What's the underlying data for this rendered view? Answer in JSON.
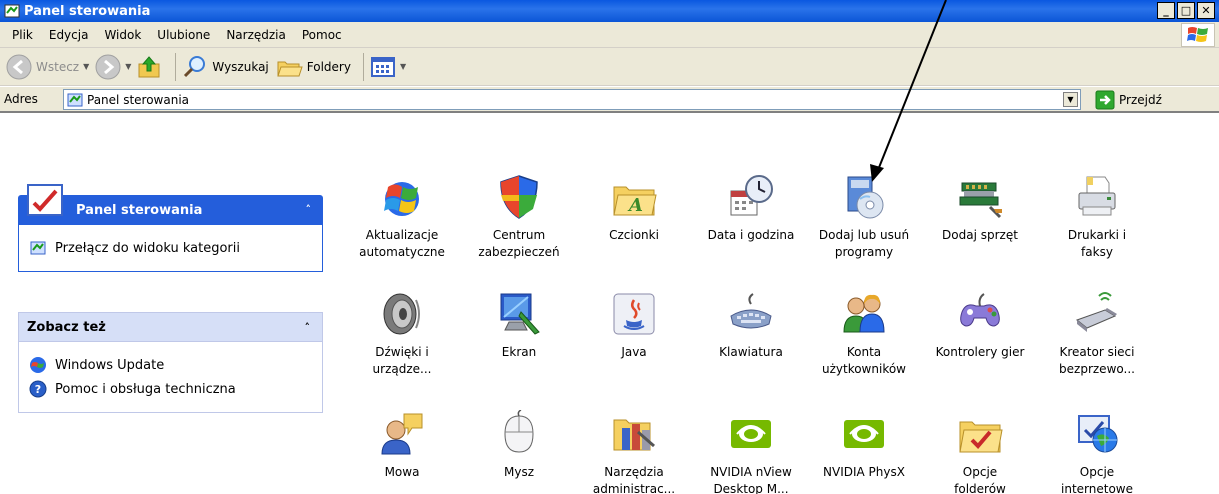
{
  "window": {
    "title": "Panel sterowania"
  },
  "menu": [
    "Plik",
    "Edycja",
    "Widok",
    "Ulubione",
    "Narzędzia",
    "Pomoc"
  ],
  "toolbar": {
    "back": "Wstecz",
    "search": "Wyszukaj",
    "folders": "Foldery"
  },
  "address": {
    "label": "Adres",
    "value": "Panel sterowania",
    "go": "Przejdź"
  },
  "left_panel": {
    "control_panel": {
      "title": "Panel sterowania",
      "switch_task": "Przełącz do widoku kategorii"
    },
    "see_also": {
      "title": "Zobacz też",
      "items": [
        "Windows Update",
        "Pomoc i obsługa techniczna"
      ]
    }
  },
  "icons": [
    {
      "l1": "Aktualizacje",
      "l2": "automatyczne",
      "icon": "windows-update-icon"
    },
    {
      "l1": "Centrum",
      "l2": "zabezpieczeń",
      "icon": "shield-icon"
    },
    {
      "l1": "Czcionki",
      "l2": "",
      "icon": "fonts-folder-icon"
    },
    {
      "l1": "Data i godzina",
      "l2": "",
      "icon": "clock-calendar-icon"
    },
    {
      "l1": "Dodaj lub usuń",
      "l2": "programy",
      "icon": "add-remove-programs-icon"
    },
    {
      "l1": "Dodaj sprzęt",
      "l2": "",
      "icon": "hardware-icon"
    },
    {
      "l1": "Drukarki i",
      "l2": "faksy",
      "icon": "printer-icon"
    },
    {
      "l1": "Dźwięki i",
      "l2": "urządze...",
      "icon": "speaker-icon"
    },
    {
      "l1": "Ekran",
      "l2": "",
      "icon": "display-icon"
    },
    {
      "l1": "Java",
      "l2": "",
      "icon": "java-icon"
    },
    {
      "l1": "Klawiatura",
      "l2": "",
      "icon": "keyboard-icon"
    },
    {
      "l1": "Konta",
      "l2": "użytkowników",
      "icon": "user-accounts-icon"
    },
    {
      "l1": "Kontrolery gier",
      "l2": "",
      "icon": "gamepad-icon"
    },
    {
      "l1": "Kreator sieci",
      "l2": "bezprzewo...",
      "icon": "wireless-network-icon"
    },
    {
      "l1": "Mowa",
      "l2": "",
      "icon": "speech-icon"
    },
    {
      "l1": "Mysz",
      "l2": "",
      "icon": "mouse-icon"
    },
    {
      "l1": "Narzędzia",
      "l2": "administrac...",
      "icon": "admin-tools-icon"
    },
    {
      "l1": "NVIDIA nView",
      "l2": "Desktop M...",
      "icon": "nvidia-icon"
    },
    {
      "l1": "NVIDIA PhysX",
      "l2": "",
      "icon": "nvidia-icon"
    },
    {
      "l1": "Opcje",
      "l2": "folderów",
      "icon": "folder-options-icon"
    },
    {
      "l1": "Opcje",
      "l2": "internetowe",
      "icon": "internet-options-icon"
    }
  ]
}
